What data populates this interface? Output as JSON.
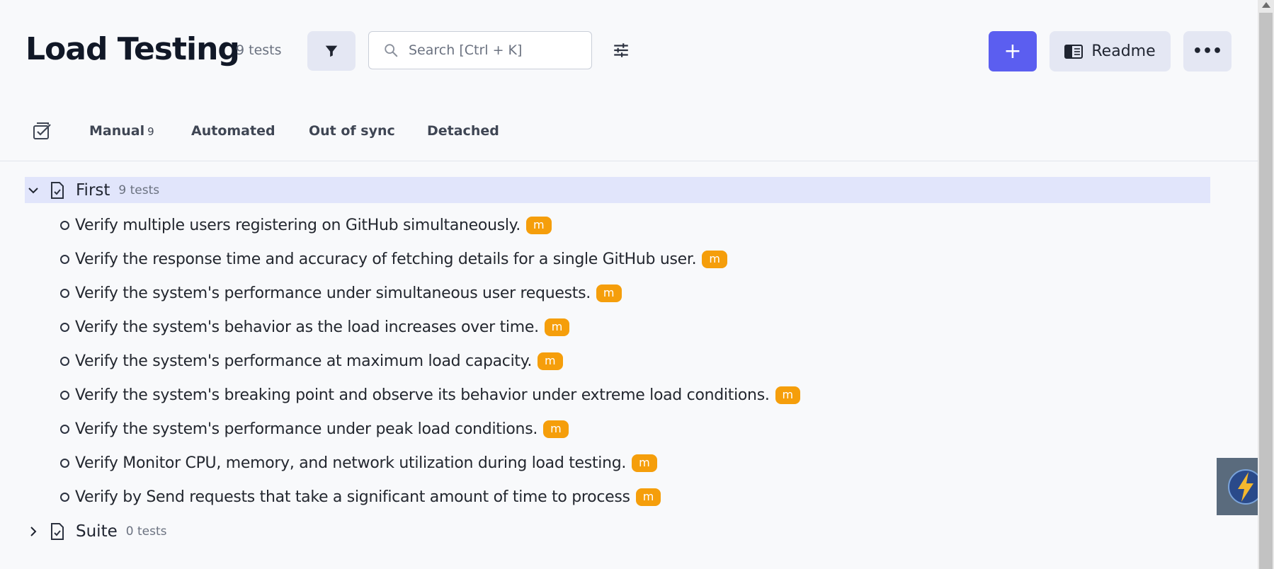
{
  "header": {
    "title": "Load Testing",
    "test_count": "9 tests",
    "search_placeholder": "Search [Ctrl + K]",
    "add_label": "+",
    "readme_label": "Readme",
    "more_label": "•••"
  },
  "tabs": [
    {
      "label": "Manual",
      "count": "9"
    },
    {
      "label": "Automated"
    },
    {
      "label": "Out of sync"
    },
    {
      "label": "Detached"
    }
  ],
  "suites": [
    {
      "name": "First",
      "count": "9 tests",
      "expanded": true,
      "tests": [
        {
          "title": "Verify multiple users registering on GitHub simultaneously.",
          "badge": "m"
        },
        {
          "title": "Verify the response time and accuracy of fetching details for a single GitHub user.",
          "badge": "m"
        },
        {
          "title": "Verify the system's performance under simultaneous user requests.",
          "badge": "m"
        },
        {
          "title": "Verify the system's behavior as the load increases over time.",
          "badge": "m"
        },
        {
          "title": "Verify the system's performance at maximum load capacity.",
          "badge": "m"
        },
        {
          "title": "Verify the system's breaking point and observe its behavior under extreme load conditions.",
          "badge": "m"
        },
        {
          "title": "Verify the system's performance under peak load conditions.",
          "badge": "m"
        },
        {
          "title": "Verify Monitor CPU, memory, and network utilization during load testing.",
          "badge": "m"
        },
        {
          "title": "Verify by Send requests that take a significant amount of time to process",
          "badge": "m"
        }
      ]
    },
    {
      "name": "Suite",
      "count": "0 tests",
      "expanded": false,
      "tests": []
    }
  ],
  "colors": {
    "accent": "#5b5ef0",
    "badge": "#f59e0b",
    "selected_row": "#e1e5fb",
    "button_bg": "#e4e7f3"
  },
  "icons": [
    "filter-icon",
    "search-icon",
    "sliders-icon",
    "plus-icon",
    "readme-book-icon",
    "more-dots-icon",
    "check-all-icon",
    "chevron-down-icon",
    "chevron-right-icon",
    "file-check-icon",
    "lightning-icon"
  ]
}
